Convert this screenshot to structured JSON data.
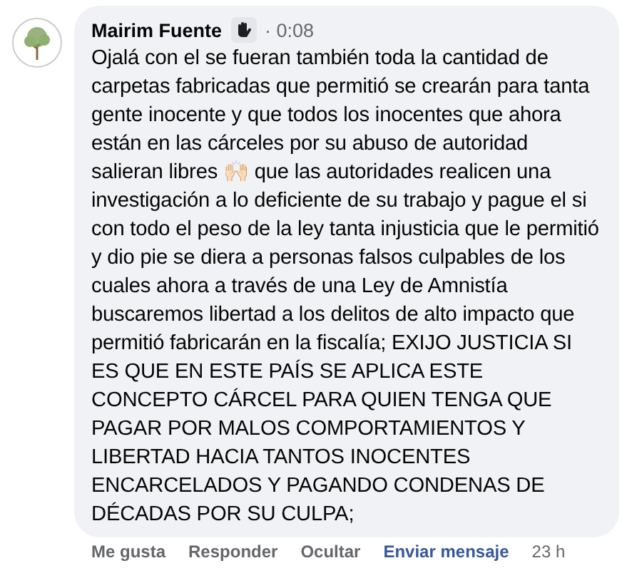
{
  "comment": {
    "author": "Mairim Fuente",
    "time_badge": "· 0:08",
    "text": "Ojalá con el se fueran también toda la cantidad de carpetas fabricadas que permitió se crearán para tanta gente inocente y que todos los inocentes que ahora están en las cárceles por su abuso de autoridad salieran libres 🙌🏻 que las autoridades realicen una investigación a lo deficiente de su trabajo y pague el si con todo el peso de la ley tanta injusticia que le permitió y dio pie se diera a personas falsos culpables de los cuales ahora a través de una Ley de Amnistía buscaremos libertad a los delitos de alto impacto que permitió fabricarán en la fiscalía; EXIJO JUSTICIA SI ES QUE EN ESTE PAÍS SE APLICA ESTE CONCEPTO CÁRCEL PARA QUIEN TENGA QUE PAGAR POR MALOS COMPORTAMIENTOS Y LIBERTAD HACIA TANTOS INOCENTES ENCARCELADOS Y PAGANDO CONDENAS DE DÉCADAS POR SU CULPA;"
  },
  "actions": [
    {
      "label": "Me gusta",
      "kind": "plain"
    },
    {
      "label": "Responder",
      "kind": "plain"
    },
    {
      "label": "Ocultar",
      "kind": "plain"
    },
    {
      "label": "Enviar mensaje",
      "kind": "link"
    }
  ],
  "timestamp": "23 h"
}
